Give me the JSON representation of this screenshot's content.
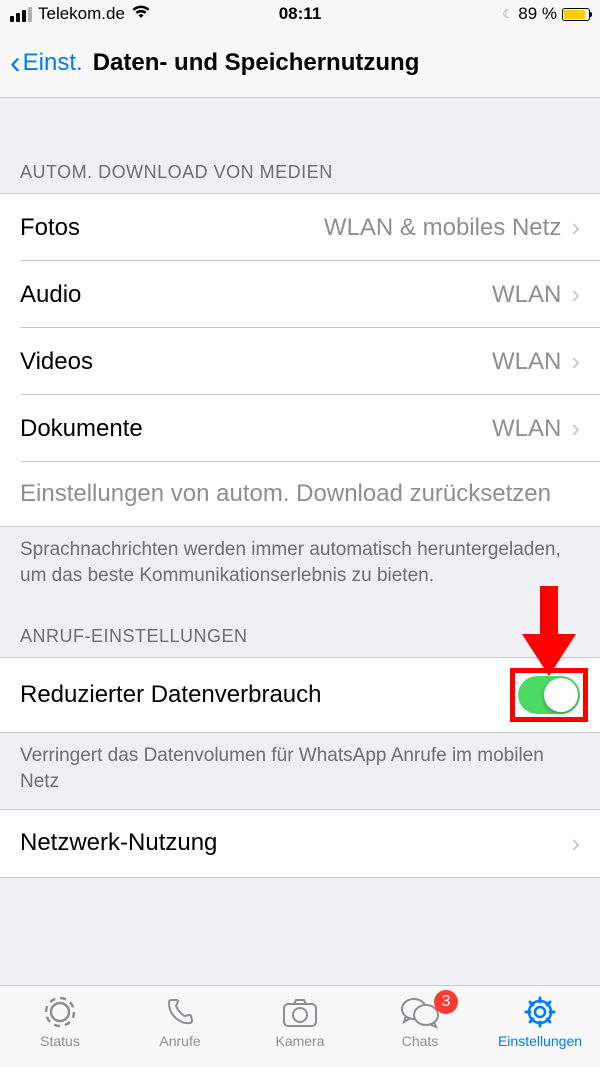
{
  "status_bar": {
    "carrier": "Telekom.de",
    "time": "08:11",
    "battery_percent": "89 %"
  },
  "nav": {
    "back_label": "Einst.",
    "title": "Daten- und Speichernutzung"
  },
  "sections": {
    "media_header": "AUTOM. DOWNLOAD VON MEDIEN",
    "media_rows": {
      "fotos": {
        "label": "Fotos",
        "value": "WLAN & mobiles Netz"
      },
      "audio": {
        "label": "Audio",
        "value": "WLAN"
      },
      "videos": {
        "label": "Videos",
        "value": "WLAN"
      },
      "dokumente": {
        "label": "Dokumente",
        "value": "WLAN"
      }
    },
    "reset_label": "Einstellungen von autom. Download zurücksetzen",
    "media_footer": "Sprachnachrichten werden immer automatisch heruntergeladen, um das beste Kommunikationserlebnis zu bieten.",
    "call_header": "ANRUF-EINSTELLUNGEN",
    "reduced_data_label": "Reduzierter Datenverbrauch",
    "reduced_data_on": true,
    "call_footer": "Verringert das Datenvolumen für WhatsApp Anrufe im mobilen Netz",
    "network_label": "Netzwerk-Nutzung"
  },
  "tabs": {
    "status": "Status",
    "anrufe": "Anrufe",
    "kamera": "Kamera",
    "chats": "Chats",
    "chats_badge": "3",
    "einstellungen": "Einstellungen"
  }
}
